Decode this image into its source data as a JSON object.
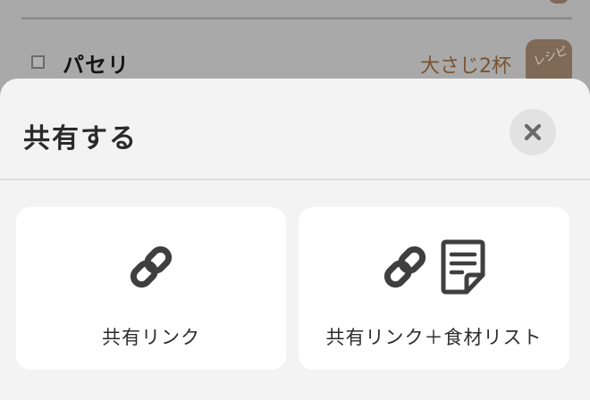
{
  "background_list": {
    "item": {
      "name": "パセリ",
      "quantity": "大さじ2杯",
      "badge": "レシピ"
    }
  },
  "share_sheet": {
    "title": "共有する",
    "close_icon": "close-icon",
    "options": [
      {
        "label": "共有リンク",
        "icons": [
          "link-icon"
        ]
      },
      {
        "label": "共有リンク＋食材リスト",
        "icons": [
          "link-icon",
          "document-icon"
        ]
      }
    ]
  },
  "colors": {
    "sheet_background": "#f3f3f3",
    "card_background": "#ffffff",
    "icon": "#3f3f3f",
    "quantity_text": "#7a5331",
    "badge": "#7e6a57"
  }
}
